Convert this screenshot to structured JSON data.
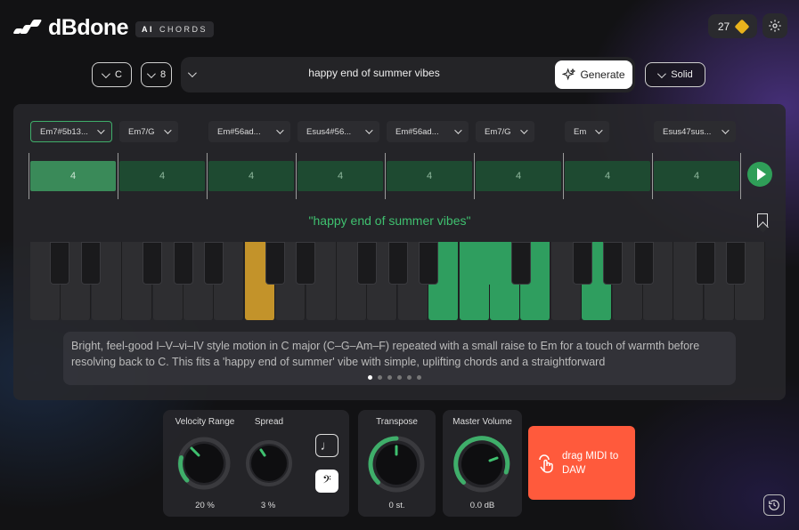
{
  "header": {
    "logo_text": "dBdone",
    "badge_ai": "AI",
    "badge_chords": "CHORDS",
    "credits": "27"
  },
  "controls": {
    "key": "C",
    "bars": "8",
    "prompt": "happy end of summer vibes",
    "generate_label": "Generate",
    "style": "Solid"
  },
  "chords": [
    {
      "label": "Em7#5b13...",
      "beats": "4",
      "selected": true
    },
    {
      "label": "Em7/G",
      "beats": "4"
    },
    {
      "label": "Em#56ad...",
      "beats": "4"
    },
    {
      "label": "Esus4#56...",
      "beats": "4"
    },
    {
      "label": "Em#56ad...",
      "beats": "4"
    },
    {
      "label": "Em7/G",
      "beats": "4"
    },
    {
      "label": "Em",
      "beats": "4"
    },
    {
      "label": "Esus47sus...",
      "beats": "4"
    }
  ],
  "progression_title": "\"happy end of summer vibes\"",
  "description": "Bright, feel-good I–V–vi–IV style motion in C major (C–G–Am–F) repeated with a small raise to Em for a touch of warmth before resolving back to C. This fits a 'happy end of summer' vibe with simple, uplifting chords and a straightforward",
  "pagination": {
    "count": 6,
    "active": 0
  },
  "knobs": {
    "velocity": {
      "label": "Velocity Range",
      "value": "20 %",
      "level": 0.2
    },
    "spread": {
      "label": "Spread",
      "value": "3 %",
      "level": 0.03
    },
    "transpose": {
      "label": "Transpose",
      "value": "0 st.",
      "level": 0.5
    },
    "master": {
      "label": "Master Volume",
      "value": "0.0 dB",
      "level": 0.75
    }
  },
  "drag_label": "drag MIDI to DAW",
  "colors": {
    "accent_green": "#3fc06f",
    "drag_orange": "#ff5a3c",
    "highlight_gold": "#c3932a"
  },
  "icons": [
    "logo-icon",
    "diamond-icon",
    "gear-icon",
    "sparkle-icon",
    "play-icon",
    "bookmark-icon",
    "note-icon",
    "bass-clef-icon",
    "drag-icon",
    "history-icon"
  ]
}
